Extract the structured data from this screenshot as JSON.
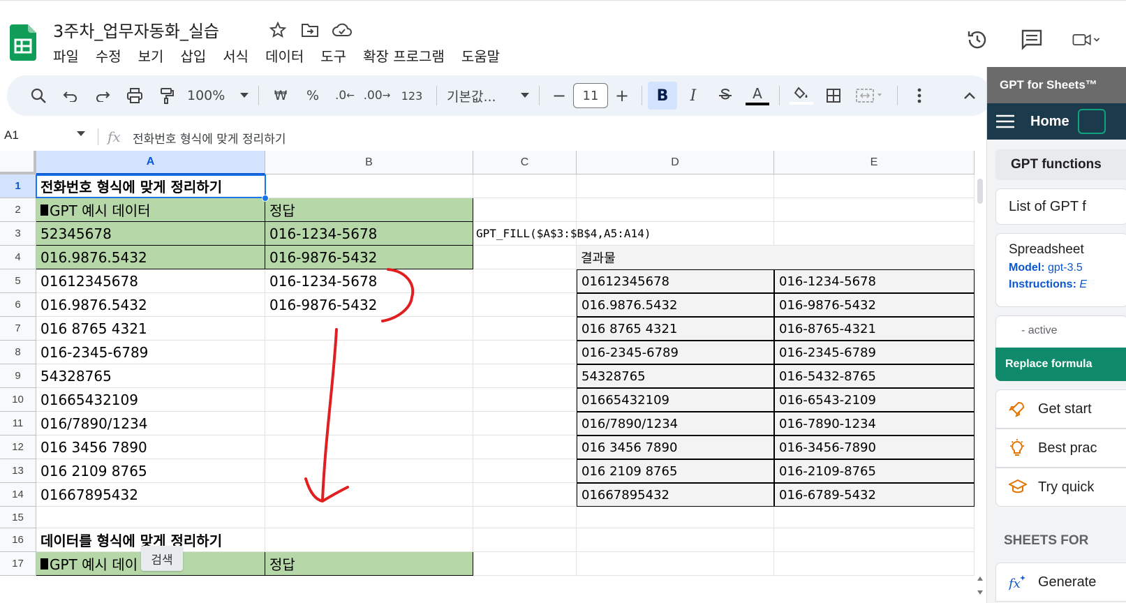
{
  "app": {
    "doc_title": "3주차_업무자동화_실습",
    "menus": [
      "파일",
      "수정",
      "보기",
      "삽입",
      "서식",
      "데이터",
      "도구",
      "확장 프로그램",
      "도움말"
    ]
  },
  "toolbar": {
    "zoom": "100%",
    "currency": "₩",
    "percent": "%",
    "decimal_less": ".0",
    "decimal_more": ".00",
    "number_format": "123",
    "font_name": "기본값...",
    "minus": "−",
    "font_size": "11",
    "plus": "+",
    "bold": "B",
    "italic": "I",
    "text_color": "A"
  },
  "formula_bar": {
    "cell_ref": "A1",
    "fx": "fx",
    "content": "전화번호 형식에 맞게 정리하기"
  },
  "columns": [
    "A",
    "B",
    "C",
    "D",
    "E"
  ],
  "rows": [
    "1",
    "2",
    "3",
    "4",
    "5",
    "6",
    "7",
    "8",
    "9",
    "10",
    "11",
    "12",
    "13",
    "14",
    "15",
    "16",
    "17"
  ],
  "cells": {
    "A1": "전화번호 형식에 맞게 정리하기",
    "A2": "GPT 예시 데이터",
    "B2": "정답",
    "A3": "52345678",
    "B3": "016-1234-5678",
    "C3": "GPT_FILL($A$3:$B$4,A5:A14)",
    "A4": "016.9876.5432",
    "B4": "016-9876-5432",
    "D4": "결과물",
    "A5": "01612345678",
    "B5": "016-1234-5678",
    "A6": "016.9876.5432",
    "B6": "016-9876-5432",
    "A7": "016 8765 4321",
    "A8": "016-2345-6789",
    "A9": "54328765",
    "A10": "01665432109",
    "A11": "016/7890/1234",
    "A12": "016 3456 7890",
    "A13": "016 2109 8765",
    "A14": "01667895432",
    "A16": "데이터를 형식에 맞게 정리하기",
    "A17": "GPT 예시 데이",
    "B17": "정답"
  },
  "results": [
    [
      "01612345678",
      "016-1234-5678"
    ],
    [
      "016.9876.5432",
      "016-9876-5432"
    ],
    [
      "016 8765 4321",
      "016-8765-4321"
    ],
    [
      "016-2345-6789",
      "016-2345-6789"
    ],
    [
      "54328765",
      "016-5432-8765"
    ],
    [
      "01665432109",
      "016-6543-2109"
    ],
    [
      "016/7890/1234",
      "016-7890-1234"
    ],
    [
      "016 3456 7890",
      "016-3456-7890"
    ],
    [
      "016 2109 8765",
      "016-2109-8765"
    ],
    [
      "01667895432",
      "016-6789-5432"
    ]
  ],
  "tooltip": "검색",
  "sidebar": {
    "header": "GPT for Sheets™",
    "nav_home": "Home",
    "tab": "GPT functions",
    "list_card": "List of GPT f",
    "spreadsheet_title": "Spreadsheet",
    "model_label": "Model:",
    "model_value": "gpt-3.5",
    "instructions_label": "Instructions:",
    "instructions_value": "E",
    "active": "- active",
    "replace_button": "Replace formula",
    "get_started": "Get start",
    "best_practices": "Best prac",
    "try_quick": "Try quick",
    "section_title": "SHEETS FOR",
    "generate": "Generate"
  },
  "colors": {
    "green_fill": "#b6d7a8",
    "selection_blue": "#1a73e8",
    "sidebar_nav": "#1b3a4b",
    "sidebar_green": "#0f8a6b",
    "annotation_red": "#e02020"
  }
}
